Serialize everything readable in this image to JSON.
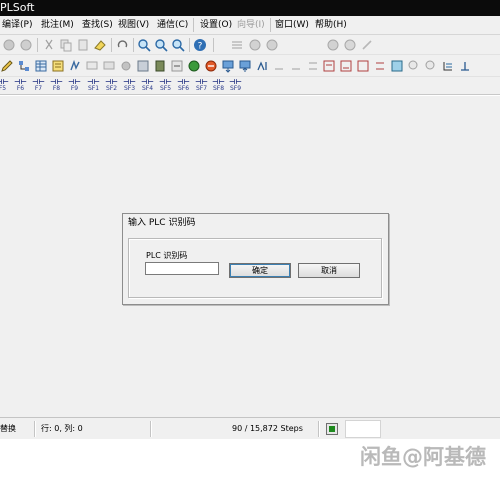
{
  "window": {
    "title": "PLSoft"
  },
  "menu": {
    "items": [
      "编译(P)",
      "批注(M)",
      "查找(S)",
      "视图(V)",
      "通信(C)",
      "设置(O)",
      "向导(I)",
      "窗口(W)",
      "帮助(H)"
    ]
  },
  "toolbar1": {
    "step_value": "1"
  },
  "fkeys": [
    {
      "glyph": "⊣⊢",
      "label": "F5"
    },
    {
      "glyph": "⊣⊢",
      "label": "F6"
    },
    {
      "glyph": "⊣⊢",
      "label": "F7"
    },
    {
      "glyph": "⊣⊢",
      "label": "F8"
    },
    {
      "glyph": "⊣⊢",
      "label": "F9"
    },
    {
      "glyph": "⊣⊢",
      "label": "SF1"
    },
    {
      "glyph": "⊣⊢",
      "label": "SF2"
    },
    {
      "glyph": "⊣⊢",
      "label": "SF3"
    },
    {
      "glyph": "⊣⊢",
      "label": "SF4"
    },
    {
      "glyph": "⊣⊢",
      "label": "SF5"
    },
    {
      "glyph": "⊣⊢",
      "label": "SF6"
    },
    {
      "glyph": "⊣⊢",
      "label": "SF7"
    },
    {
      "glyph": "⊣⊢",
      "label": "SF8"
    },
    {
      "glyph": "⊣⊢",
      "label": "SF9"
    }
  ],
  "dialog": {
    "title": "输入 PLC 识别码",
    "field_label": "PLC 识别码",
    "field_value": "",
    "ok_label": "确定",
    "cancel_label": "取消"
  },
  "status": {
    "mode": "替换",
    "cursor": "行: 0, 列: 0",
    "steps": "90 / 15,872 Steps",
    "run_color": "#1e8a1e"
  },
  "watermark": {
    "text": "闲鱼@阿基德"
  },
  "colors": {
    "face": "#f0f0f0",
    "titlebar": "#0b0b0b",
    "accent": "#2a3a8a"
  }
}
